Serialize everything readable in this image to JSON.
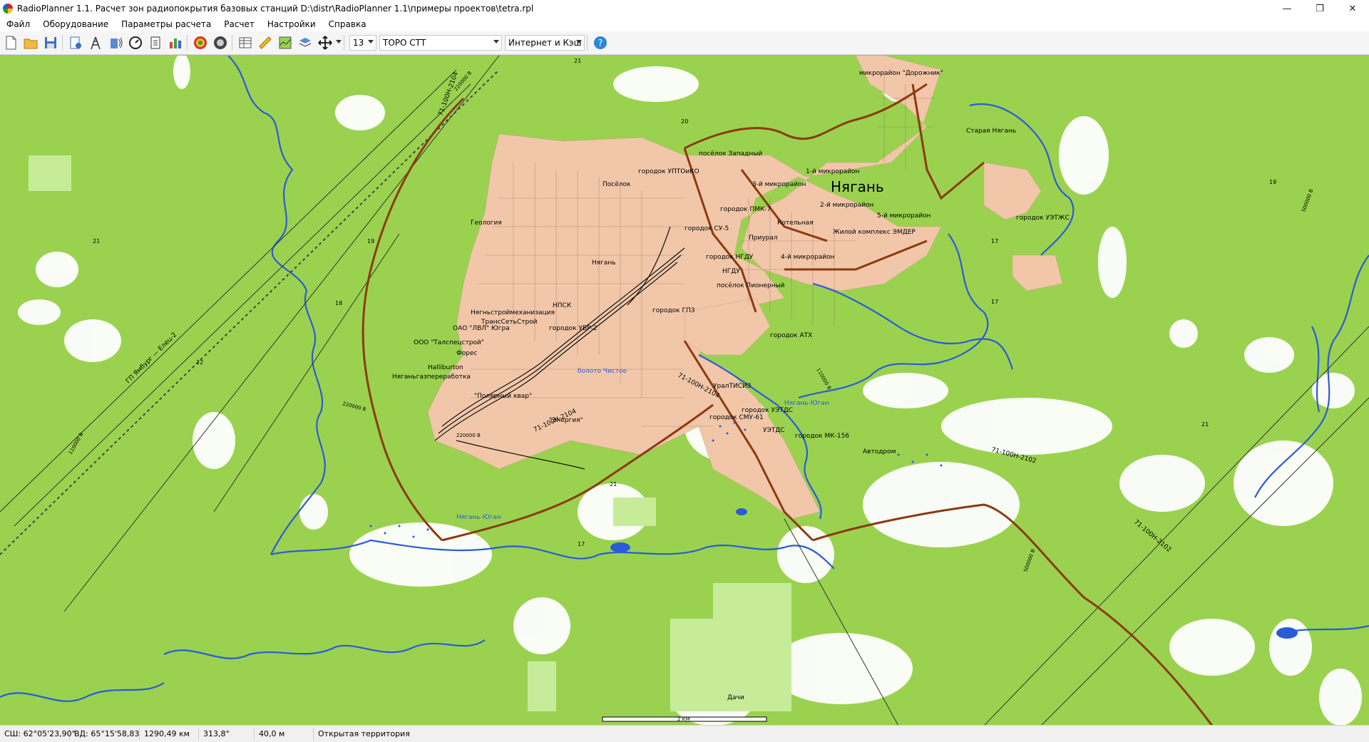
{
  "window": {
    "title": "RadioPlanner 1.1. Расчет зон радиопокрытия базовых станций D:\\distr\\RadioPlanner 1.1\\примеры проектов\\tetra.rpl",
    "minimize": "—",
    "maximize": "❐",
    "close": "✕"
  },
  "menu": [
    "Файл",
    "Оборудование",
    "Параметры расчета",
    "Расчет",
    "Настройки",
    "Справка"
  ],
  "toolbar": {
    "icons": [
      "new-file-icon",
      "open-folder-icon",
      "save-icon",
      "properties-icon",
      "antenna-tower-icon",
      "radio-equipment-icon",
      "calculate-icon",
      "report-icon",
      "bar-chart-icon",
      "coverage-map-icon",
      "coverage-gray-icon",
      "table-icon",
      "ruler-icon",
      "profile-icon",
      "map-layers-icon",
      "pan-move-icon"
    ],
    "zoom_level": "13",
    "map_type": "TOPO СТТ",
    "cache_mode": "Интернет и Кэш",
    "help_icon": "help-icon"
  },
  "map": {
    "city_name": "Нягань",
    "labels": [
      "микрорайон \"Дорожник\"",
      "Старая Нягань",
      "посёлок Западный",
      "городок УПТОиКО",
      "Посёлок",
      "1-й микрорайон",
      "3-й микрорайон",
      "городок ПМК-7",
      "2-й микрорайон",
      "5-й микрорайон",
      "городок СУ-5",
      "Котельная",
      "Геология",
      "Жилой комплекс ЭМДЕР",
      "Приурал",
      "4-й микрорайон",
      "Нягань",
      "городок НГДУ",
      "НГДУ",
      "посёлок Пионерный",
      "городок УЭТЖС",
      "НПСК",
      "Нягньстроймеханизация",
      "ТрансСетьСтрой",
      "ОАО \"ЛВЛ\" Югра",
      "городок УБР-2",
      "городок ГПЗ",
      "ООО \"Талспецстрой\"",
      "Форес",
      "Halliburton",
      "Няганьгазпереработка",
      "\"Полярный квар\"",
      "болото Чистое",
      "городок АТХ",
      "УралТИСИЗ",
      "городок УЭТДС",
      "городок СМУ-61",
      "УЭТДС",
      "городок МК-156",
      "Автодром",
      "Дачи",
      "\"Энергия\"",
      "Нягань-Юган",
      "Нягань-Юган"
    ],
    "road_labels": [
      "71-100Н-2104",
      "71-100Н-2104",
      "71-100Н-2104",
      "71-100Н-2102",
      "71-100Н-2102",
      "ГП Ямбург — Елец-2"
    ],
    "power_labels": [
      "220000 В",
      "220000 В",
      "220000 В",
      "110000 В",
      "110000 В",
      "500000 В",
      "500000 В"
    ],
    "elevation_labels": [
      "21",
      "20",
      "21",
      "19",
      "18",
      "22",
      "17",
      "17",
      "19",
      "21",
      "21",
      "17"
    ],
    "scale_label": "2 КМ"
  },
  "status": {
    "lat": "СШ: 62°05'23,90\"",
    "lon": "ВД: 65°15'58,83",
    "distance": "1290,49 км",
    "azimuth": "313,8°",
    "height": "40,0 м",
    "terrain": "Открытая территория"
  },
  "colors": {
    "forest": "#9ad24f",
    "urban": "#f2c7a9",
    "water": "#2b5bd7",
    "road": "#8b3a10"
  }
}
